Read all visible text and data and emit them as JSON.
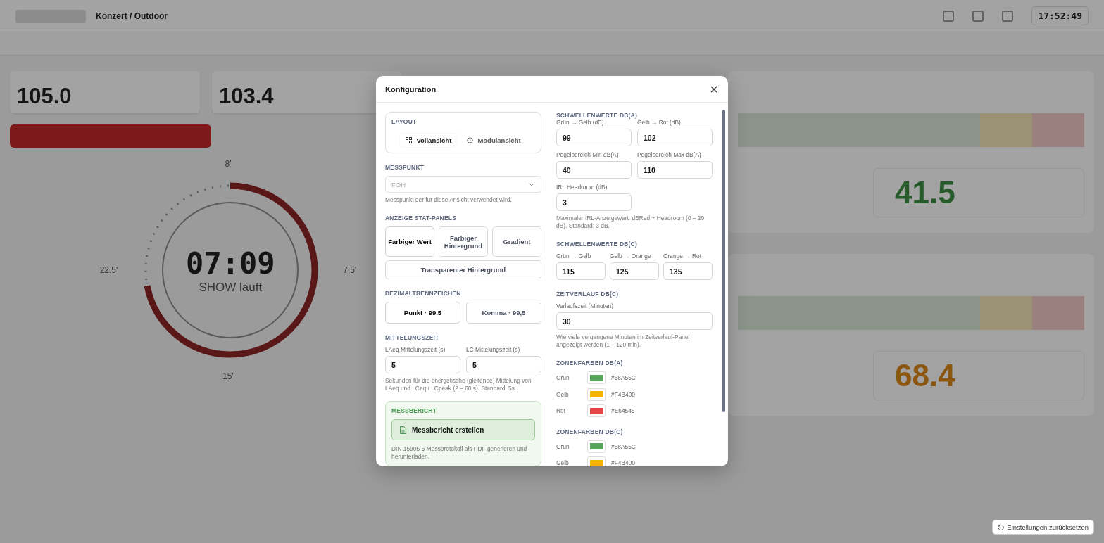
{
  "background": {
    "header_title": "Konzert / Outdoor",
    "clock": "17:52:49",
    "cards": [
      {
        "value": "105.0"
      },
      {
        "value": "103.4"
      }
    ],
    "timer": {
      "time": "07:09",
      "status": "SHOW läuft",
      "level": 0.72,
      "marks": [
        "8'",
        "7.5'",
        "15'",
        "22.5'"
      ]
    },
    "stat_values": [
      {
        "value": "41.5",
        "kind": "ok"
      },
      {
        "value": "68.4",
        "kind": "warning"
      }
    ]
  },
  "dialog": {
    "title": "Konfiguration",
    "layout": {
      "heading": "LAYOUT",
      "options": [
        {
          "label": "Vollansicht",
          "selected": true
        },
        {
          "label": "Modulansicht",
          "selected": false
        }
      ]
    },
    "messpunkt": {
      "heading": "MESSPUNKT",
      "placeholder": "FOH",
      "hint": "Messpunkt der für diese Ansicht verwendet wird."
    },
    "stat_panels": {
      "heading": "ANZEIGE STAT-PANELS",
      "options": [
        {
          "label": "Farbiger Wert",
          "selected": true
        },
        {
          "label": "Farbiger Hintergrund",
          "selected": false
        },
        {
          "label": "Gradient",
          "selected": false
        },
        {
          "label": "Transparenter Hintergrund",
          "selected": false
        }
      ]
    },
    "decimal": {
      "heading": "DEZIMALTRENNZEICHEN",
      "options": [
        {
          "label": "Punkt · 99.5",
          "selected": true
        },
        {
          "label": "Komma · 99,5",
          "selected": false
        }
      ]
    },
    "averaging": {
      "heading": "MITTELUNGSZEIT",
      "fields": [
        {
          "label": "LAeq Mittelungszeit (s)",
          "value": "5"
        },
        {
          "label": "LC Mittelungszeit (s)",
          "value": "5"
        }
      ],
      "hint": "Sekunden für die energetische (gleitende) Mittelung von LAeq und LCeq / LCpeak (2 – 60 s). Standard: 5s."
    },
    "report": {
      "heading": "MESSBERICHT",
      "button": "Messbericht erstellen",
      "hint": "DIN 15905-5 Messprotokoll als PDF generieren und herunterladen."
    },
    "thresholds_a": {
      "heading": "SCHWELLENWERTE DB(A)",
      "fields": [
        {
          "label": "Grün → Gelb (dB)",
          "value": "99"
        },
        {
          "label": "Gelb → Rot (dB)",
          "value": "102"
        },
        {
          "label": "Pegelbereich Min dB(A)",
          "value": "40"
        },
        {
          "label": "Pegelbereich Max dB(A)",
          "value": "110"
        },
        {
          "label": "IRL Headroom (dB)",
          "value": "3"
        }
      ],
      "hint": "Maximaler IRL-Anzeigewert: dBRed + Headroom (0 – 20 dB). Standard: 3 dB."
    },
    "thresholds_c": {
      "heading": "SCHWELLENWERTE DB(C)",
      "fields": [
        {
          "label": "Grün → Gelb",
          "value": "115"
        },
        {
          "label": "Gelb → Orange",
          "value": "125"
        },
        {
          "label": "Orange → Rot",
          "value": "135"
        }
      ]
    },
    "history": {
      "heading": "ZEITVERLAUF DB(C)",
      "field": {
        "label": "Verlaufszeit (Minuten)",
        "value": "30"
      },
      "hint": "Wie viele vergangene Minuten im Zeitverlauf-Panel angezeigt werden (1 – 120 min)."
    },
    "zone_colors_a": {
      "heading": "ZONENFARBEN DB(A)",
      "rows": [
        {
          "label": "Grün",
          "color": "#58a55c",
          "hex": "#58A55C"
        },
        {
          "label": "Gelb",
          "color": "#f4b400",
          "hex": "#F4B400"
        },
        {
          "label": "Rot",
          "color": "#e64545",
          "hex": "#E64545"
        }
      ]
    },
    "zone_colors_c": {
      "heading": "ZONENFARBEN DB(C)",
      "rows": [
        {
          "label": "Grün",
          "color": "#58a55c",
          "hex": "#58A55C"
        },
        {
          "label": "Gelb",
          "color": "#f4b400",
          "hex": "#F4B400"
        }
      ]
    }
  },
  "reset_button": "Einstellungen zurücksetzen"
}
